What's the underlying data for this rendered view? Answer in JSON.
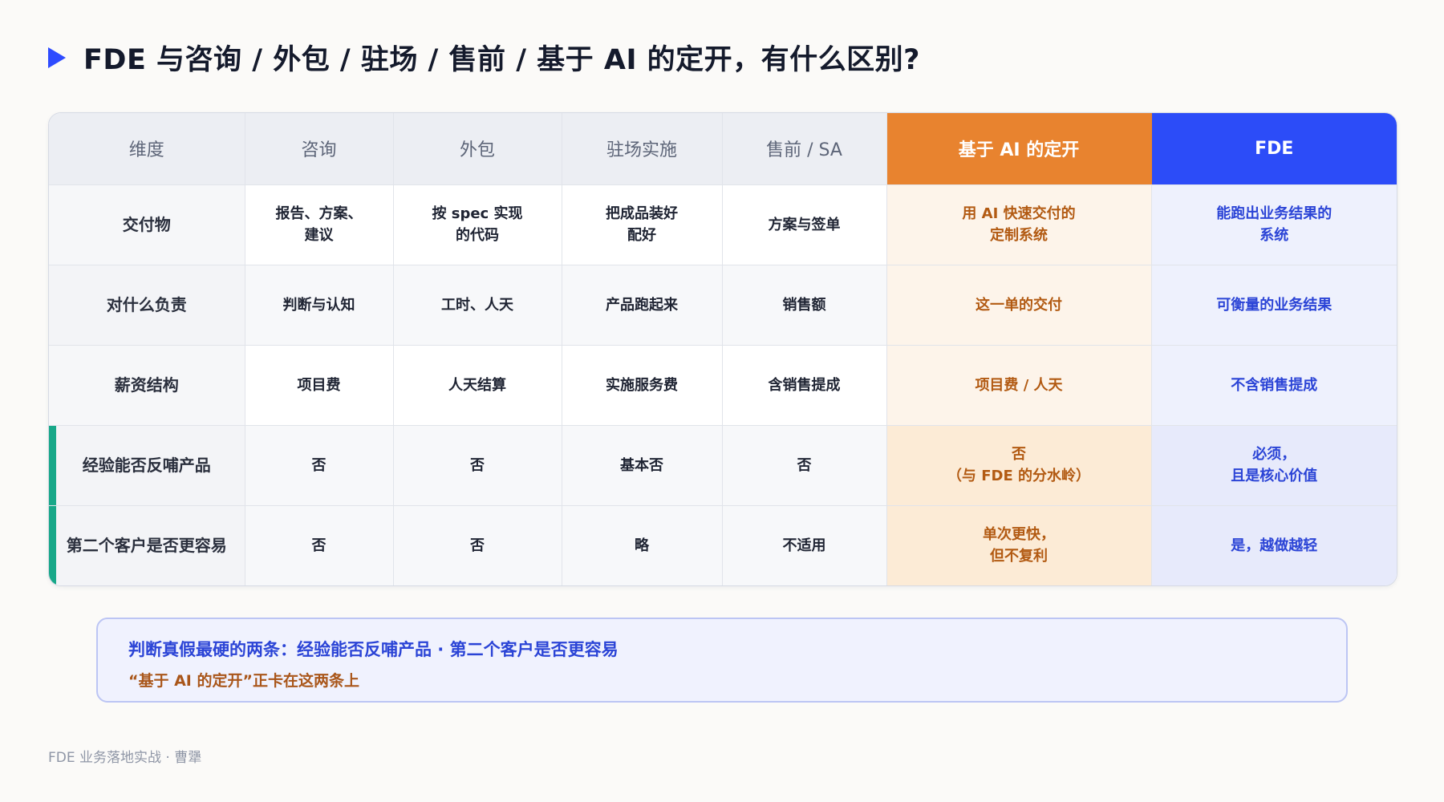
{
  "title": "FDE 与咨询 / 外包 / 驻场 / 售前 / 基于 AI 的定开，有什么区别?",
  "colors": {
    "accent_blue": "#2c4cf8",
    "accent_orange": "#e8832f",
    "accent_teal": "#18a889"
  },
  "table": {
    "headers": [
      "维度",
      "咨询",
      "外包",
      "驻场实施",
      "售前 / SA",
      "基于 AI 的定开",
      "FDE"
    ],
    "rows": [
      {
        "dimension": "交付物",
        "cells": [
          "报告、方案、\n建议",
          "按 spec 实现\n的代码",
          "把成品装好\n配好",
          "方案与签单",
          "用 AI 快速交付的\n定制系统",
          "能跑出业务结果的\n系统"
        ]
      },
      {
        "dimension": "对什么负责",
        "cells": [
          "判断与认知",
          "工时、人天",
          "产品跑起来",
          "销售额",
          "这一单的交付",
          "可衡量的业务结果"
        ]
      },
      {
        "dimension": "薪资结构",
        "cells": [
          "项目费",
          "人天结算",
          "实施服务费",
          "含销售提成",
          "项目费 / 人天",
          "不含销售提成"
        ]
      },
      {
        "dimension": "经验能否反哺产品",
        "cells": [
          "否",
          "否",
          "基本否",
          "否",
          "否\n（与 FDE 的分水岭）",
          "必须，\n且是核心价值"
        ]
      },
      {
        "dimension": "第二个客户是否更容易",
        "cells": [
          "否",
          "否",
          "略",
          "不适用",
          "单次更快，\n但不复利",
          "是，越做越轻"
        ]
      }
    ]
  },
  "callout": {
    "line1": "判断真假最硬的两条：经验能否反哺产品 · 第二个客户是否更容易",
    "line2": "“基于 AI 的定开”正卡在这两条上"
  },
  "footer": "FDE 业务落地实战 · 曹犟"
}
